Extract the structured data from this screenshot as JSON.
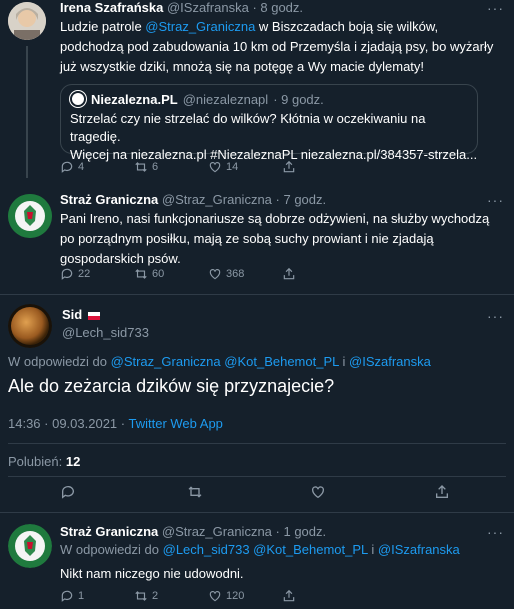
{
  "tweet1": {
    "name": "Irena Szafrańska",
    "handle": "@ISzafranska",
    "time": "· 8 godz.",
    "text_pre": "Ludzie patrole ",
    "mention": "@Straz_Graniczna",
    "text_post": " w Biszczadach boją się wilków, podchodzą pod zabudowania 10 km od Przemyśla i zjadają psy, bo wyżarły już wszystkie dziki, mnożą się na potęgę a Wy macie dylematy!",
    "quote": {
      "name": "Niezalezna.PL",
      "handle": "@niezaleznapl",
      "time": "· 9 godz.",
      "line1": "Strzelać czy nie strzelać do wilków? Kłótnia w oczekiwaniu na tragedię.",
      "line2": "Więcej na niezalezna.pl #NiezaleznaPL niezalezna.pl/384357-strzela..."
    },
    "replies": "4",
    "retweets": "6",
    "likes": "14"
  },
  "tweet2": {
    "name": "Straż Graniczna",
    "handle": "@Straz_Graniczna",
    "time": "· 7 godz.",
    "text": "Pani Ireno, nasi funkcjonariusze są dobrze odżywieni, na służby wychodzą po porządnym posiłku, mają ze sobą suchy prowiant i nie zjadają gospodarskich psów.",
    "replies": "22",
    "retweets": "60",
    "likes": "368"
  },
  "tweet3": {
    "name": "Sid",
    "flag": "🇵🇱",
    "handle": "@Lech_sid733",
    "reply_prefix": "W odpowiedzi do",
    "reply_to": "@Straz_Graniczna @Kot_Behemot_PL",
    "reply_and": "i",
    "reply_last": "@ISzafranska",
    "text": "Ale do zeżarcia dzików się przyznajecie?",
    "timestamp": "14:36 · 09.03.2021 ·",
    "source": "Twitter Web App",
    "likes_label": "Polubień:",
    "likes_count": "12"
  },
  "tweet4": {
    "name": "Straż Graniczna",
    "handle": "@Straz_Graniczna",
    "time": "· 1 godz.",
    "reply_prefix": "W odpowiedzi do",
    "reply_to": "@Lech_sid733 @Kot_Behemot_PL",
    "reply_and": "i",
    "reply_last": "@ISzafranska",
    "text": "Nikt nam niczego nie udowodni.",
    "replies": "1",
    "retweets": "2",
    "likes": "120"
  },
  "more_label": "···"
}
